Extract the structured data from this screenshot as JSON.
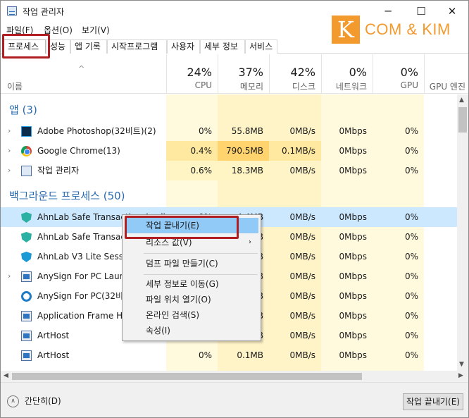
{
  "window": {
    "title": "작업 관리자",
    "minimize": "─",
    "maximize": "☐",
    "close": "✕"
  },
  "menu": [
    "파일(F)",
    "옵션(O)",
    "보기(V)"
  ],
  "logo": {
    "letter": "K",
    "text": "COM & KIM"
  },
  "tabs": [
    "프로세스",
    "성능",
    "앱 기록",
    "시작프로그램",
    "사용자",
    "세부 정보",
    "서비스"
  ],
  "header": {
    "name": "이름",
    "sort_glyph": "^",
    "columns": [
      {
        "pct": "24%",
        "label": "CPU"
      },
      {
        "pct": "37%",
        "label": "메모리"
      },
      {
        "pct": "42%",
        "label": "디스크"
      },
      {
        "pct": "0%",
        "label": "네트워크"
      },
      {
        "pct": "0%",
        "label": "GPU"
      },
      {
        "pct": "",
        "label": "GPU 엔진"
      }
    ]
  },
  "groups": {
    "apps": "앱 (3)",
    "background": "백그라운드 프로세스 (50)"
  },
  "rows": [
    {
      "name": "Adobe Photoshop(32비트)(2)",
      "expand": "›",
      "icon": "photoshop-icon",
      "cpu": "0%",
      "mem": "55.8MB",
      "disk": "0MB/s",
      "net": "0Mbps",
      "gpu": "0%"
    },
    {
      "name": "Google Chrome(13)",
      "expand": "›",
      "icon": "chrome-icon",
      "cpu": "0.4%",
      "mem": "790.5MB",
      "disk": "0.1MB/s",
      "net": "0Mbps",
      "gpu": "0%"
    },
    {
      "name": "작업 관리자",
      "expand": "›",
      "icon": "task-manager-icon",
      "cpu": "0.6%",
      "mem": "18.3MB",
      "disk": "0MB/s",
      "net": "0Mbps",
      "gpu": "0%"
    },
    {
      "name": "AhnLab Safe Transaction Appli",
      "expand": "",
      "icon": "ahnlab-shield-icon",
      "cpu": "0%",
      "mem": "4.4MB",
      "disk": "0MB/s",
      "net": "0Mbps",
      "gpu": "0%"
    },
    {
      "name": "AhnLab Safe Transacti",
      "expand": "",
      "icon": "ahnlab-shield-icon",
      "cpu": "",
      "mem": "B",
      "disk": "0MB/s",
      "net": "0Mbps",
      "gpu": "0%"
    },
    {
      "name": "AhnLab V3 Lite Sessic",
      "expand": "",
      "icon": "v3-shield-icon",
      "cpu": "",
      "mem": "B",
      "disk": "0MB/s",
      "net": "0Mbps",
      "gpu": "0%"
    },
    {
      "name": "AnySign For PC Launc",
      "expand": "›",
      "icon": "app-window-icon",
      "cpu": "",
      "mem": "B",
      "disk": "0MB/s",
      "net": "0Mbps",
      "gpu": "0%"
    },
    {
      "name": "AnySign For PC(32비트",
      "expand": "",
      "icon": "anysign-ring-icon",
      "cpu": "",
      "mem": "B",
      "disk": "0MB/s",
      "net": "0Mbps",
      "gpu": "0%"
    },
    {
      "name": "Application Frame Ho",
      "expand": "",
      "icon": "app-window-icon",
      "cpu": "",
      "mem": "B",
      "disk": "0MB/s",
      "net": "0Mbps",
      "gpu": "0%"
    },
    {
      "name": "ArtHost",
      "expand": "",
      "icon": "app-window-icon",
      "cpu": "",
      "mem": "B",
      "disk": "0MB/s",
      "net": "0Mbps",
      "gpu": "0%"
    },
    {
      "name": "ArtHost",
      "expand": "",
      "icon": "app-window-icon",
      "cpu": "0%",
      "mem": "0.1MB",
      "disk": "0MB/s",
      "net": "0Mbps",
      "gpu": "0%"
    }
  ],
  "context_menu": {
    "end_task": "작업 끝내기(E)",
    "resource_values": "리소스 값(V)",
    "submenu_arrow": "›",
    "dump": "덤프 파일 만들기(C)",
    "go_details": "세부 정보로 이동(G)",
    "open_location": "파일 위치 열기(O)",
    "search_online": "온라인 검색(S)",
    "properties": "속성(I)"
  },
  "footer": {
    "fewer_details": "간단히(D)",
    "chevron": "∧",
    "end_task_button": "작업 끝내기(E)"
  },
  "colors": {
    "highlight_box": "#b01e22",
    "group_blue": "#2b6cb0",
    "selected_row": "#cce8ff",
    "menu_hover": "#91c9f7",
    "logo_orange": "#f39a2f"
  }
}
